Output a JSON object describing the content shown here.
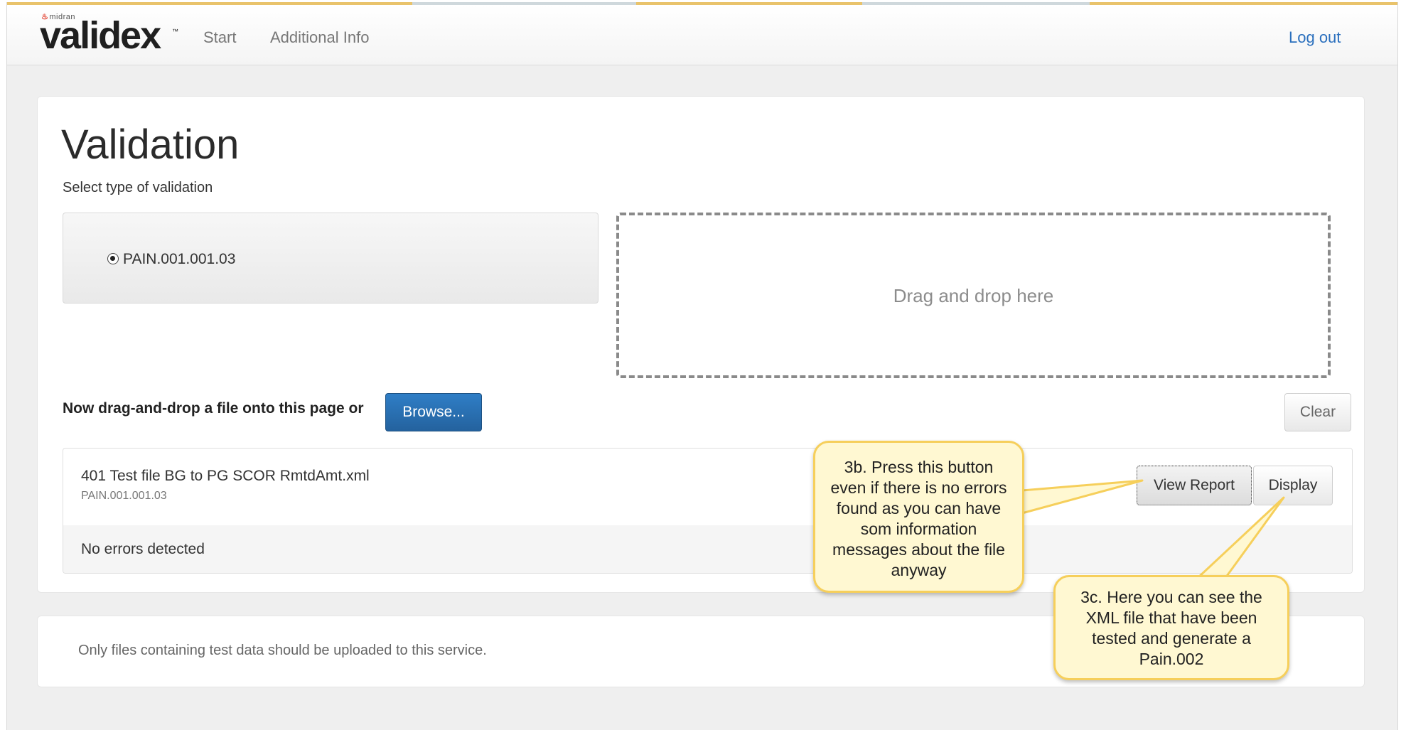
{
  "navbar": {
    "brand_small": "midran",
    "brand_main": "validex",
    "brand_tm": "™",
    "links": [
      {
        "label": "Start"
      },
      {
        "label": "Additional Info"
      }
    ],
    "logout_label": "Log out"
  },
  "main": {
    "title": "Validation",
    "subtitle": "Select type of validation",
    "radio_option": "PAIN.001.001.03",
    "dropzone_text": "Drag and drop here",
    "instruction": "Now drag-and-drop a file onto this page or",
    "browse_label": "Browse...",
    "clear_label": "Clear",
    "file": {
      "name": "401 Test file BG to PG SCOR RmtdAmt.xml",
      "type": "PAIN.001.001.03",
      "view_report_label": "View Report",
      "display_label": "Display",
      "status": "No errors detected"
    }
  },
  "footer": {
    "text": "Only files containing test data should be uploaded to this service."
  },
  "callouts": {
    "c3b": "3b. Press this button even if there is no errors found as you can have som information messages about the file anyway",
    "c3c": "3c. Here you can see the XML file that have been tested and generate a Pain.002"
  },
  "colors": {
    "accent_blue": "#2a6fbd",
    "browse_button": "#2a70b3",
    "callout_fill": "#fff8d2",
    "callout_border": "#f6cf5b",
    "top_stripe": "#e9c36b"
  }
}
